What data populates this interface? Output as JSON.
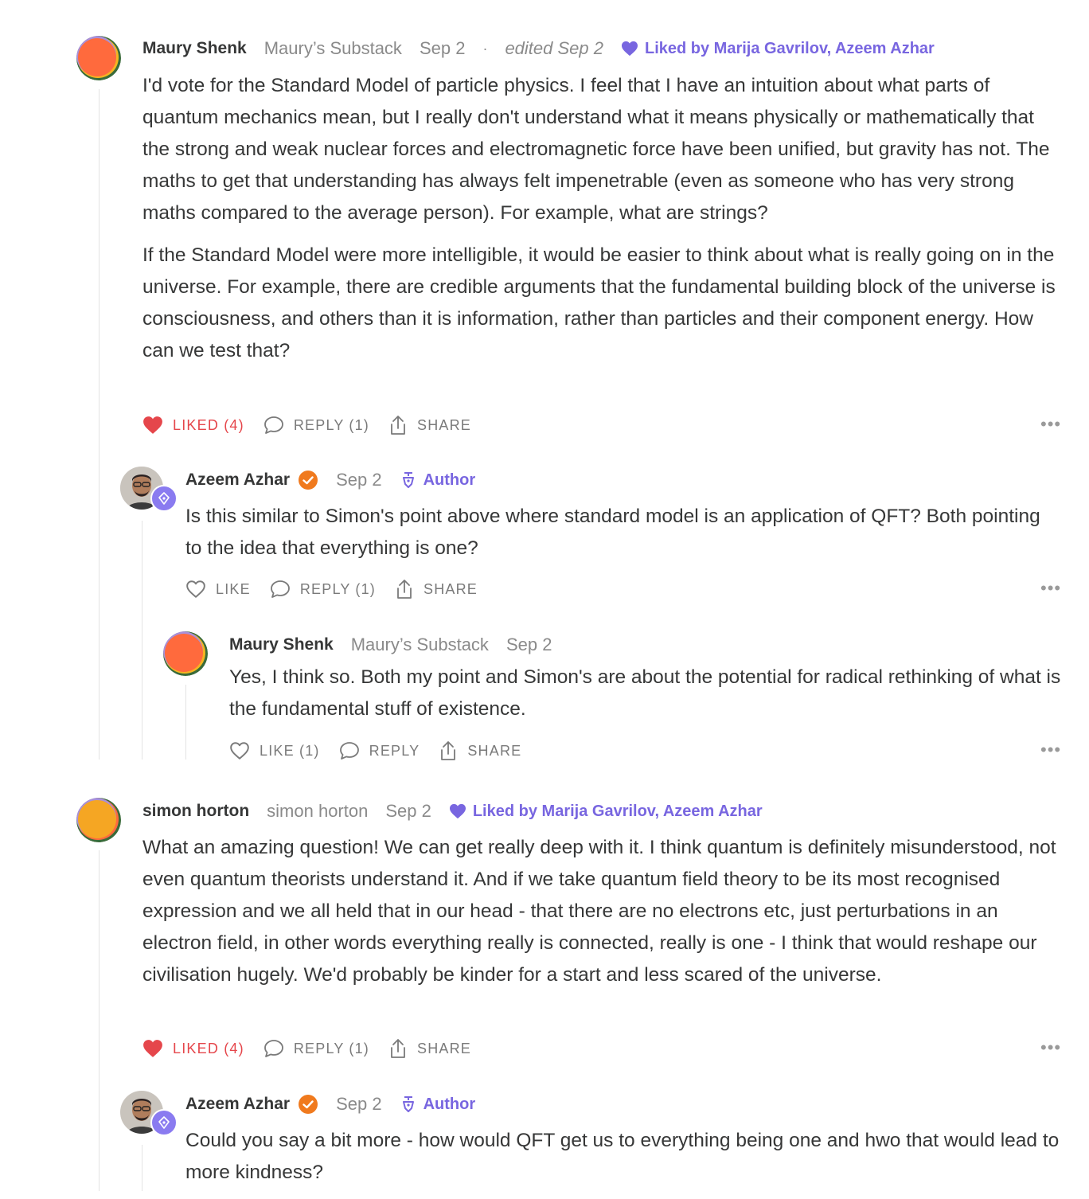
{
  "colors": {
    "accent": "#7866e0",
    "liked_red": "#e5464b",
    "text": "#363737",
    "muted": "#8a8a8a",
    "verified_orange": "#f07a1e"
  },
  "comments": [
    {
      "author": "Maury Shenk",
      "publication": "Maury’s Substack",
      "date": "Sep 2",
      "separator": "·",
      "edited": "edited Sep 2",
      "liked_by": "Liked by Marija Gavrilov, Azeem Azhar",
      "paragraphs": [
        "I'd vote for the Standard Model of particle physics. I feel that I have an intuition about what parts of quantum mechanics mean, but I really don't understand what it means physically or mathematically that the strong and weak nuclear forces and electromagnetic force have been unified, but gravity has not. The maths to get that understanding has always felt impenetrable (even as someone who has very strong maths compared to the average person). For example, what are strings?",
        "If the Standard Model were more intelligible, it would be easier to think about what is really going on in the universe. For example, there are credible arguments that the fundamental building block of the universe is consciousness, and others than it is information, rather than particles and their component energy. How can we test that?"
      ],
      "actions": {
        "like": "LIKED (4)",
        "reply": "REPLY (1)",
        "share": "SHARE"
      },
      "more": "•••"
    },
    {
      "author": "Azeem Azhar",
      "date": "Sep 2",
      "author_badge": "Author",
      "paragraphs": [
        "Is this similar to Simon's point above where standard model is an application of QFT? Both pointing to the idea that everything is one?"
      ],
      "actions": {
        "like": "LIKE",
        "reply": "REPLY (1)",
        "share": "SHARE"
      },
      "more": "•••"
    },
    {
      "author": "Maury Shenk",
      "publication": "Maury’s Substack",
      "date": "Sep 2",
      "paragraphs": [
        "Yes, I think so. Both my point and Simon's are about the potential for radical rethinking of what is the fundamental stuff of existence."
      ],
      "actions": {
        "like": "LIKE (1)",
        "reply": "REPLY",
        "share": "SHARE"
      },
      "more": "•••"
    },
    {
      "author": "simon horton",
      "publication": "simon horton",
      "date": "Sep 2",
      "liked_by": "Liked by Marija Gavrilov, Azeem Azhar",
      "paragraphs": [
        "What an amazing question! We can get really deep with it. I think quantum is definitely misunderstood, not even quantum theorists understand it. And if we take quantum field theory to be its most recognised expression and we all held that in our head - that there are no electrons etc, just perturbations in an electron field, in other words everything really is connected, really is one - I think that would reshape our civilisation hugely. We'd probably be kinder for a start and less scared of the universe."
      ],
      "actions": {
        "like": "LIKED (4)",
        "reply": "REPLY (1)",
        "share": "SHARE"
      },
      "more": "•••"
    },
    {
      "author": "Azeem Azhar",
      "date": "Sep 2",
      "author_badge": "Author",
      "paragraphs": [
        "Could you say a bit more - how would QFT get us to everything being one and hwo that would lead to more kindness?"
      ]
    }
  ]
}
